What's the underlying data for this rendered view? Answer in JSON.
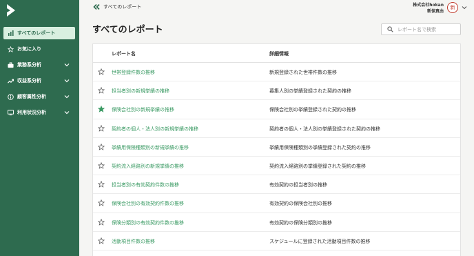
{
  "header": {
    "back_label": "すべてのレポート",
    "company_name": "株式会社hokan",
    "user_name": "新保真由",
    "avatar_initial": "新"
  },
  "sidebar": {
    "items": [
      {
        "label": "すべてのレポート",
        "icon": "bar-chart-icon",
        "active": true,
        "expandable": false
      },
      {
        "label": "お気に入り",
        "icon": "star-icon",
        "active": false,
        "expandable": false
      },
      {
        "label": "業務系分析",
        "icon": "briefcase-icon",
        "active": false,
        "expandable": true
      },
      {
        "label": "収益系分析",
        "icon": "trend-icon",
        "active": false,
        "expandable": true
      },
      {
        "label": "顧客属性分析",
        "icon": "info-icon",
        "active": false,
        "expandable": true
      },
      {
        "label": "利用状況分析",
        "icon": "monitor-icon",
        "active": false,
        "expandable": true
      }
    ]
  },
  "main": {
    "title": "すべてのレポート",
    "search_placeholder": "レポート名で検索",
    "table": {
      "columns": [
        "レポート名",
        "詳細情報"
      ],
      "rows": [
        {
          "name": "世帯登録件数の推移",
          "desc": "新規登録された世帯件数の推移",
          "favorite": false
        },
        {
          "name": "担当者別の新規挙績の推移",
          "desc": "募集人別の挙績登録された契約の推移",
          "favorite": false
        },
        {
          "name": "保険会社別の新規挙績の推移",
          "desc": "保険会社別の挙績登録された契約の推移",
          "favorite": true
        },
        {
          "name": "契約者の個人・法人別の新規挙績の推移",
          "desc": "契約者の個人・法人別の挙績登録された契約の推移",
          "favorite": false
        },
        {
          "name": "挙績用保険種類別の新規挙績の推移",
          "desc": "挙績用保険種類別の挙績登録された契約の推移",
          "favorite": false
        },
        {
          "name": "契約流入経路別の新規挙績の推移",
          "desc": "契約流入経路別の挙績登録された契約の推移",
          "favorite": false
        },
        {
          "name": "担当者別の有効契約件数の推移",
          "desc": "有効契約の担当者別の推移",
          "favorite": false
        },
        {
          "name": "保険会社別の有効契約件数の推移",
          "desc": "有効契約の保険会社別の推移",
          "favorite": false
        },
        {
          "name": "保険分類別の有効契約件数の推移",
          "desc": "有効契約の保険分類別の推移",
          "favorite": false
        },
        {
          "name": "活動項目件数の推移",
          "desc": "スケジュールに登録された活動項目件数の推移",
          "favorite": false
        }
      ]
    }
  },
  "colors": {
    "sidebar_bg": "#2e6b4f",
    "accent": "#3a9a63",
    "active_item_bg": "#d9efe0"
  }
}
